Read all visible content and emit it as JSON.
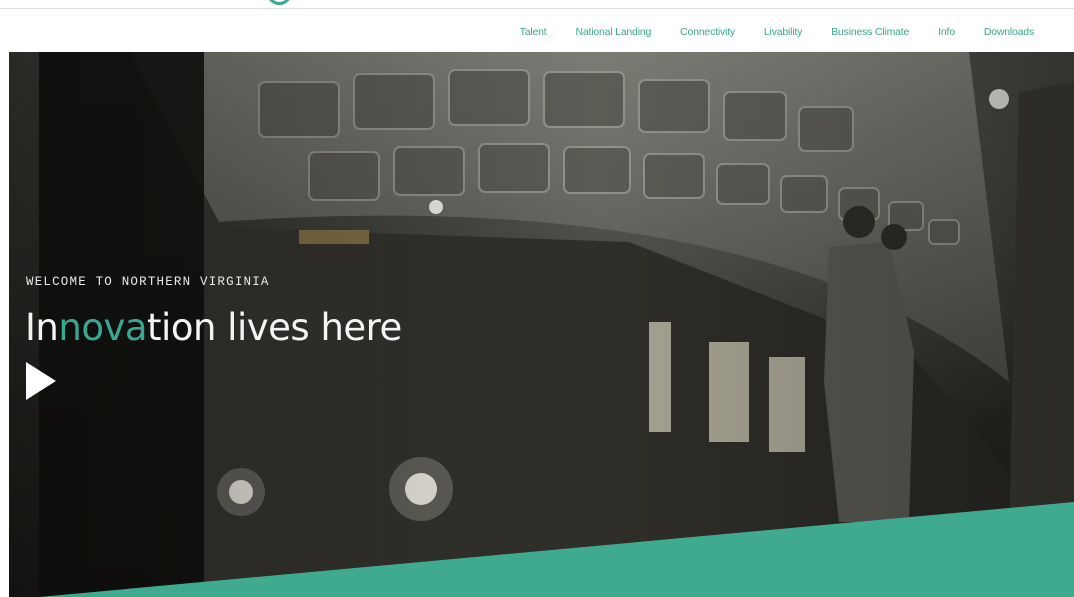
{
  "nav": {
    "items": [
      {
        "label": "Talent"
      },
      {
        "label": "National Landing"
      },
      {
        "label": "Connectivity"
      },
      {
        "label": "Livability"
      },
      {
        "label": "Business Climate"
      },
      {
        "label": "Info"
      },
      {
        "label": "Downloads"
      }
    ]
  },
  "hero": {
    "eyebrow": "WELCOME TO NORTHERN VIRGINIA",
    "headline": {
      "part1": "In",
      "accent1": "nova",
      "part2": "tion lives here"
    },
    "play_icon": "play-icon"
  },
  "colors": {
    "accent": "#3aa890",
    "band": "#3faa8e",
    "headline": "#f4f4f4"
  }
}
